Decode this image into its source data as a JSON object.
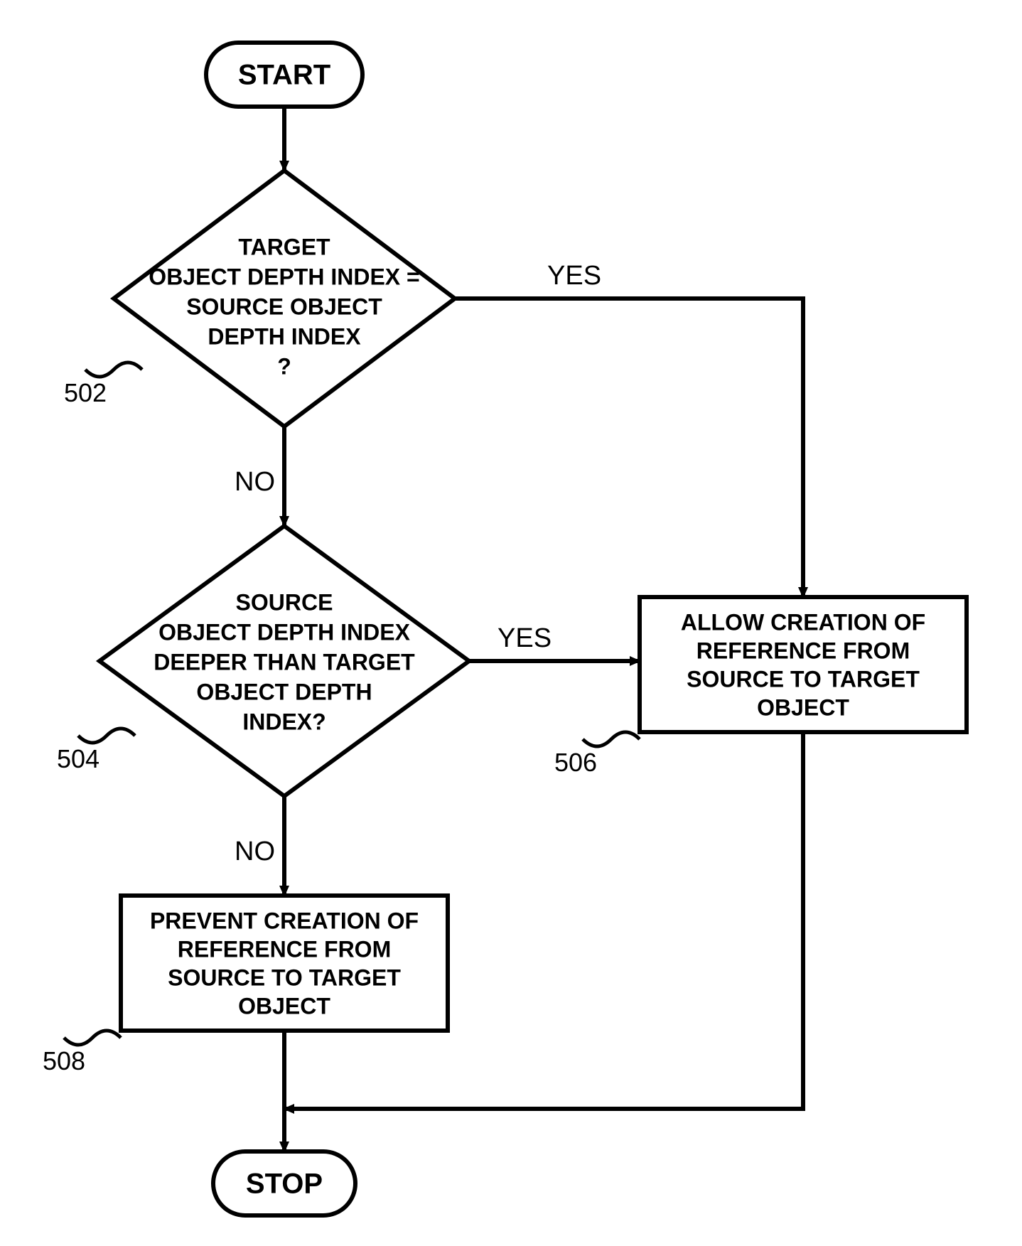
{
  "flowchart": {
    "start": {
      "label": "START"
    },
    "stop": {
      "label": "STOP"
    },
    "decision1": {
      "ref": "502",
      "lines": [
        "TARGET",
        "OBJECT DEPTH INDEX =",
        "SOURCE OBJECT",
        "DEPTH INDEX",
        "?"
      ]
    },
    "decision2": {
      "ref": "504",
      "lines": [
        "SOURCE",
        "OBJECT DEPTH INDEX",
        "DEEPER THAN TARGET",
        "OBJECT DEPTH",
        "INDEX?"
      ]
    },
    "processAllow": {
      "ref": "506",
      "lines": [
        "ALLOW CREATION OF",
        "REFERENCE FROM",
        "SOURCE TO TARGET",
        "OBJECT"
      ]
    },
    "processPrevent": {
      "ref": "508",
      "lines": [
        "PREVENT CREATION OF",
        "REFERENCE FROM",
        "SOURCE TO TARGET",
        "OBJECT"
      ]
    },
    "edges": {
      "yes": "YES",
      "no": "NO"
    }
  }
}
